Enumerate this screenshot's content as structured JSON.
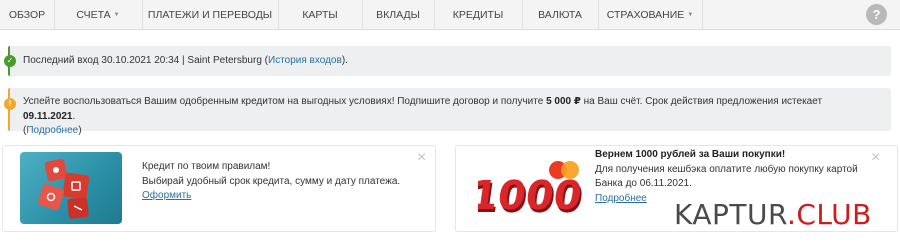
{
  "nav": {
    "items": [
      {
        "label": "ОБЗОР",
        "dropdown": false
      },
      {
        "label": "СЧЕТА",
        "dropdown": true
      },
      {
        "label": "ПЛАТЕЖИ И ПЕРЕВОДЫ",
        "dropdown": false
      },
      {
        "label": "КАРТЫ",
        "dropdown": false
      },
      {
        "label": "ВКЛАДЫ",
        "dropdown": false
      },
      {
        "label": "КРЕДИТЫ",
        "dropdown": false
      },
      {
        "label": "ВАЛЮТА",
        "dropdown": false
      },
      {
        "label": "СТРАХОВАНИЕ",
        "dropdown": true
      }
    ],
    "help_label": "?"
  },
  "last_login": {
    "text": "Последний вход 30.10.2021 20:34 | Saint Petersburg (",
    "link": "История входов",
    "suffix": ").",
    "color": "#4a9a2e"
  },
  "offer_notice": {
    "part1": "Успейте воспользоваться Вашим одобренным кредитом на выгодных условиях! Подпишите договор и получите ",
    "amount": "5 000 ₽",
    "part2": " на Ваш счёт. Срок действия предложения истекает ",
    "date": "09.11.2021",
    "part3": ".",
    "open_paren": "(",
    "link": "Подробнее",
    "close_paren": ")",
    "color": "#f0a830"
  },
  "card_credit": {
    "line1": "Кредит по твоим правилам!",
    "line2": "Выбирай удобный срок кредита, сумму и дату платежа.",
    "link": "Оформить",
    "close": "×"
  },
  "card_cashback": {
    "title": "Вернем 1000 рублей за Ваши покупки!",
    "line1": "Для получения кешбэка оплатите любую покупку картой",
    "line2": "Банка до 06.11.2021.",
    "link": "Подробнее",
    "badge": "1000",
    "close": "×"
  },
  "watermark": {
    "name": "KAPTUR",
    "dot": ".",
    "tld": "CLUB"
  }
}
